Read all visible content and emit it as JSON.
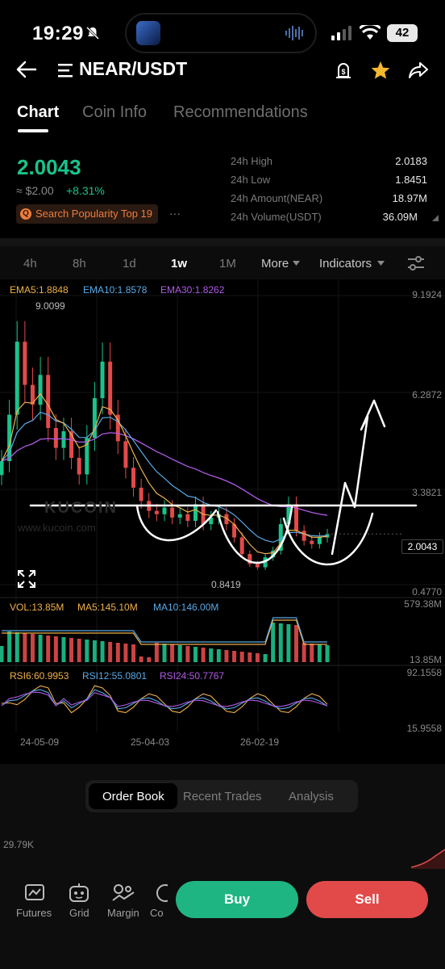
{
  "status_bar": {
    "time": "19:29",
    "battery": "42"
  },
  "header": {
    "pair": "NEAR/USDT"
  },
  "tabs": [
    {
      "label": "Chart"
    },
    {
      "label": "Coin Info"
    },
    {
      "label": "Recommendations"
    }
  ],
  "ticker": {
    "price": "2.0043",
    "usd": "≈ $2.00",
    "change": "+8.31%",
    "popularity": "Search Popularity Top 19",
    "more": "···",
    "stats": [
      {
        "label": "24h High",
        "value": "2.0183"
      },
      {
        "label": "24h Low",
        "value": "1.8451"
      },
      {
        "label": "24h Amount(NEAR)",
        "value": "18.97M"
      },
      {
        "label": "24h Volume(USDT)",
        "value": "36.09M"
      }
    ]
  },
  "intervals": [
    "4h",
    "8h",
    "1d",
    "1w",
    "1M",
    "More",
    "Indicators"
  ],
  "active_interval": "1w",
  "chart_data": {
    "type": "candlestick",
    "indicators": {
      "ema5": "EMA5:1.8848",
      "ema10": "EMA10:1.8578",
      "ema30": "EMA30:1.8262",
      "vol": "VOL:13.85M",
      "ma5": "MA5:145.10M",
      "ma10": "MA10:146.00M",
      "rsi6": "RSI6:60.9953",
      "rsi12": "RSI12:55.0801",
      "rsi24": "RSI24:50.7767"
    },
    "price_axis": [
      "9.1924",
      "6.2872",
      "3.3821",
      "2.0043",
      "0.4770"
    ],
    "volume_axis": [
      "579.38M",
      "13.85M"
    ],
    "rsi_axis": [
      "92.1558",
      "15.9558"
    ],
    "x_ticks": [
      "24-05-09",
      "25-04-03",
      "26-02-19"
    ],
    "max_label": "9.0099",
    "min_label": "0.8419",
    "current_price": "2.0043",
    "watermark_brand": "KUCOIN",
    "watermark_url": "www.kucoin.com",
    "close_series": [
      4.2,
      5.6,
      7.8,
      6.5,
      5.9,
      6.8,
      5.2,
      4.6,
      5.1,
      4.3,
      3.8,
      4.9,
      6.1,
      7.2,
      5.6,
      4.8,
      4.0,
      3.4,
      3.0,
      2.7,
      2.6,
      2.8,
      2.5,
      2.6,
      2.4,
      2.9,
      2.3,
      2.5,
      2.6,
      2.3,
      1.9,
      1.4,
      1.1,
      1.0,
      1.3,
      1.5,
      2.3,
      2.9,
      2.1,
      1.8,
      1.7,
      1.9,
      2.0
    ],
    "colors": {
      "up": "#19c38c",
      "down": "#e24a4a",
      "ema5": "#f0b04a",
      "ema10": "#5aa9e6",
      "ema30": "#b05ae6"
    }
  },
  "order_tabs": [
    "Order Book",
    "Recent Trades",
    "Analysis"
  ],
  "depth_label": "29.79K",
  "bottom_nav": [
    "Futures",
    "Grid",
    "Margin",
    "Co"
  ],
  "actions": {
    "buy": "Buy",
    "sell": "Sell"
  }
}
